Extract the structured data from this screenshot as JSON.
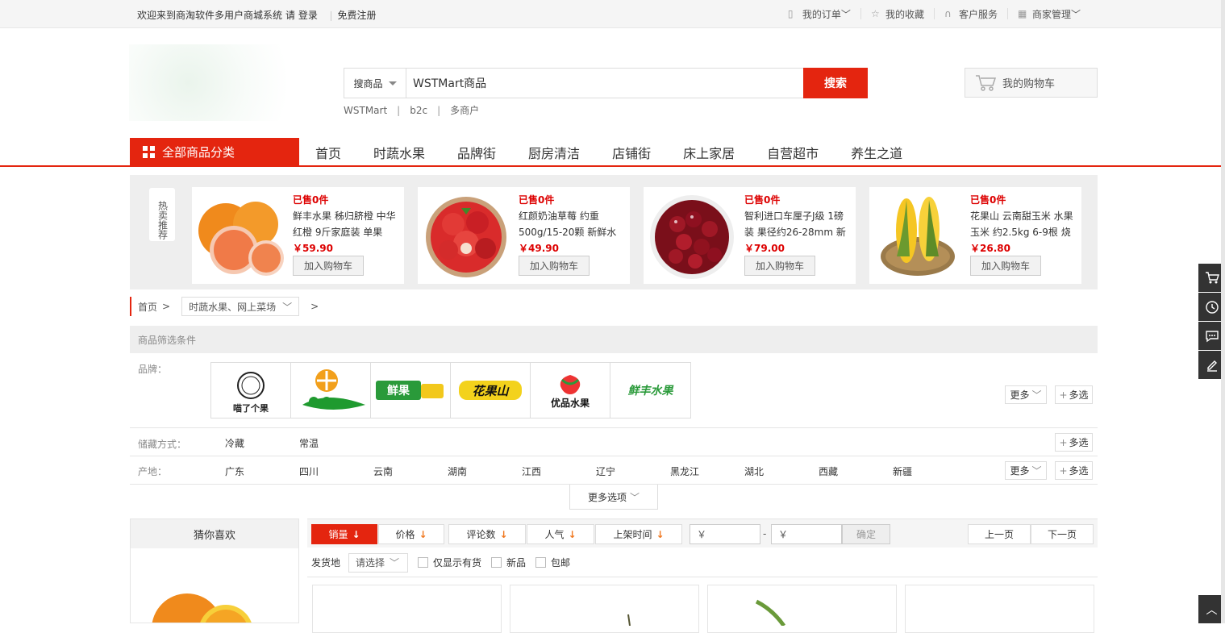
{
  "topbar": {
    "welcome": "欢迎来到商淘软件多用户商城系统",
    "login": "请 登录",
    "register": "免费注册",
    "my_orders": "我的订单",
    "my_favorites": "我的收藏",
    "customer_service": "客户服务",
    "merchant_admin": "商家管理"
  },
  "search": {
    "type": "搜商品",
    "value": "WSTMart商品",
    "button": "搜索",
    "hotwords": [
      "WSTMart",
      "b2c",
      "多商户"
    ]
  },
  "cart": {
    "label": "我的购物车"
  },
  "nav": {
    "all_categories": "全部商品分类",
    "links": [
      "首页",
      "时蔬水果",
      "品牌街",
      "厨房清洁",
      "店铺街",
      "床上家居",
      "自营超市",
      "养生之道"
    ]
  },
  "hot": {
    "tag": "热卖推荐",
    "items": [
      {
        "sold": "已售0件",
        "title": "鲜丰水果 秭归脐橙 中华红橙 9斤家庭装 单果",
        "price": "￥59.90",
        "add": "加入购物车"
      },
      {
        "sold": "已售0件",
        "title": "红颜奶油草莓 约重500g/15-20颗 新鲜水",
        "price": "￥49.90",
        "add": "加入购物车"
      },
      {
        "sold": "已售0件",
        "title": "智利进口车厘子J级 1磅装 果径约26-28mm 新",
        "price": "￥79.00",
        "add": "加入购物车"
      },
      {
        "sold": "已售0件",
        "title": "花果山 云南甜玉米 水果玉米 约2.5kg 6-9根 烧",
        "price": "￥26.80",
        "add": "加入购物车"
      }
    ]
  },
  "breadcrumb": {
    "home": "首页",
    "sep": ">",
    "category": "时蔬水果、网上菜场",
    "sep2": ">"
  },
  "filters": {
    "header": "商品筛选条件",
    "brand_label": "品牌：",
    "brands": [
      "喵了个果",
      "",
      "鲜果",
      "花果山",
      "优品水果",
      "鲜丰水果"
    ],
    "storage_label": "储藏方式：",
    "storage": [
      "冷藏",
      "常温"
    ],
    "origin_label": "产地：",
    "origins": [
      "广东",
      "四川",
      "云南",
      "湖南",
      "江西",
      "辽宁",
      "黑龙江",
      "湖北",
      "西藏",
      "新疆"
    ],
    "more": "更多",
    "multi": "多选",
    "more_options": "更多选项"
  },
  "guess": {
    "title": "猜你喜欢"
  },
  "sort": {
    "items": [
      "销量",
      "价格",
      "评论数",
      "人气",
      "上架时间"
    ],
    "price_min_placeholder": "￥",
    "price_dash": "-",
    "price_max_placeholder": "￥",
    "confirm": "确定",
    "prev": "上一页",
    "next": "下一页"
  },
  "ship": {
    "label": "发货地",
    "select": "请选择",
    "in_stock": "仅显示有货",
    "new": "新品",
    "free_ship": "包邮"
  },
  "colors": {
    "accent": "#e4250f",
    "price": "#dd0000"
  }
}
